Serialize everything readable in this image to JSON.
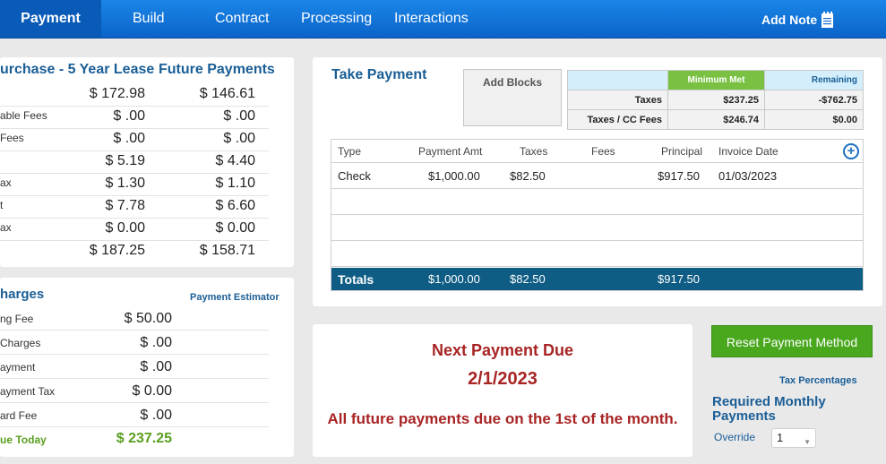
{
  "nav": {
    "tabs": [
      "Payment",
      "Build",
      "Contract",
      "Processing",
      "Interactions"
    ],
    "add_note": "Add Note"
  },
  "lease": {
    "col1_title": "urchase - 5 Year Lease",
    "col2_title": "Future Payments",
    "rows": [
      {
        "label": "",
        "v1": "$ 172.98",
        "v2": "$ 146.61"
      },
      {
        "label": "able Fees",
        "v1": "$ .00",
        "v2": "$ .00"
      },
      {
        "label": "Fees",
        "v1": "$ .00",
        "v2": "$ .00"
      },
      {
        "label": "",
        "v1": "$ 5.19",
        "v2": "$ 4.40"
      },
      {
        "label": "ax",
        "v1": "$ 1.30",
        "v2": "$ 1.10"
      },
      {
        "label": "t",
        "v1": "$ 7.78",
        "v2": "$ 6.60"
      },
      {
        "label": "ax",
        "v1": "$ 0.00",
        "v2": "$ 0.00"
      },
      {
        "label": "",
        "v1": "$ 187.25",
        "v2": "$ 158.71"
      }
    ]
  },
  "charges": {
    "title": "harges",
    "estimator": "Payment Estimator",
    "rows": [
      {
        "label": "ng Fee",
        "value": "$ 50.00"
      },
      {
        "label": "Charges",
        "value": "$ .00"
      },
      {
        "label": "ayment",
        "value": "$ .00"
      },
      {
        "label": "ayment Tax",
        "value": "$ 0.00"
      },
      {
        "label": "ard Fee",
        "value": "$ .00"
      },
      {
        "label": "ue Today",
        "value": "$ 237.25"
      }
    ]
  },
  "take_payment": {
    "title": "Take Payment",
    "add_blocks": "Add Blocks",
    "summary": {
      "headers": [
        "Minimum Met",
        "Remaining"
      ],
      "rows": [
        {
          "label": "Taxes",
          "min": "$237.25",
          "rem": "-$762.75"
        },
        {
          "label": "Taxes / CC Fees",
          "min": "$246.74",
          "rem": "$0.00"
        }
      ]
    },
    "columns": [
      "Type",
      "Payment Amt",
      "Taxes",
      "Fees",
      "Principal",
      "Invoice Date"
    ],
    "rows": [
      {
        "type": "Check",
        "amount": "$1,000.00",
        "taxes": "$82.50",
        "fees": "",
        "principal": "$917.50",
        "date": "01/03/2023"
      }
    ],
    "totals": {
      "label": "Totals",
      "amount": "$1,000.00",
      "taxes": "$82.50",
      "principal": "$917.50"
    }
  },
  "next_payment": {
    "title": "Next Payment Due",
    "date": "2/1/2023",
    "note": "All future payments due on the 1st of the month."
  },
  "right": {
    "reset_button": "Reset Payment Method",
    "tax_percentages": "Tax Percentages",
    "required_line1": "Required Monthly",
    "required_line2": "Payments",
    "override_label": "Override",
    "override_value": "1"
  }
}
